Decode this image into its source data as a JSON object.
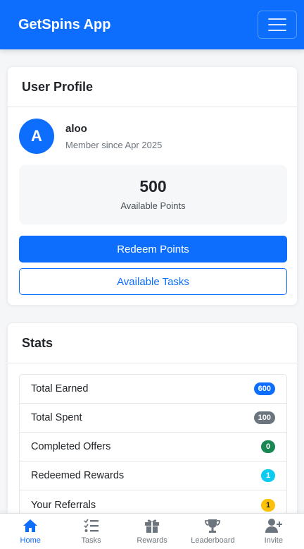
{
  "app": {
    "title": "GetSpins App"
  },
  "profile": {
    "header": "User Profile",
    "avatar_letter": "A",
    "username": "aloo",
    "member_since": "Member since Apr 2025",
    "points_value": "500",
    "points_label": "Available Points",
    "redeem_label": "Redeem Points",
    "tasks_label": "Available Tasks"
  },
  "stats": {
    "header": "Stats",
    "items": [
      {
        "label": "Total Earned",
        "value": "600",
        "color": "#0d6efd"
      },
      {
        "label": "Total Spent",
        "value": "100",
        "color": "#6c757d"
      },
      {
        "label": "Completed Offers",
        "value": "0",
        "color": "#198754"
      },
      {
        "label": "Redeemed Rewards",
        "value": "1",
        "color": "#0dcaf0"
      },
      {
        "label": "Your Referrals",
        "value": "1",
        "color": "#ffc107"
      }
    ]
  },
  "bottom_nav": {
    "items": [
      {
        "label": "Home",
        "icon": "home-icon",
        "active": true
      },
      {
        "label": "Tasks",
        "icon": "tasks-icon",
        "active": false
      },
      {
        "label": "Rewards",
        "icon": "gift-icon",
        "active": false
      },
      {
        "label": "Leaderboard",
        "icon": "trophy-icon",
        "active": false
      },
      {
        "label": "Invite",
        "icon": "user-plus-icon",
        "active": false
      }
    ]
  },
  "colors": {
    "primary": "#0d6efd",
    "secondary": "#6c757d"
  }
}
